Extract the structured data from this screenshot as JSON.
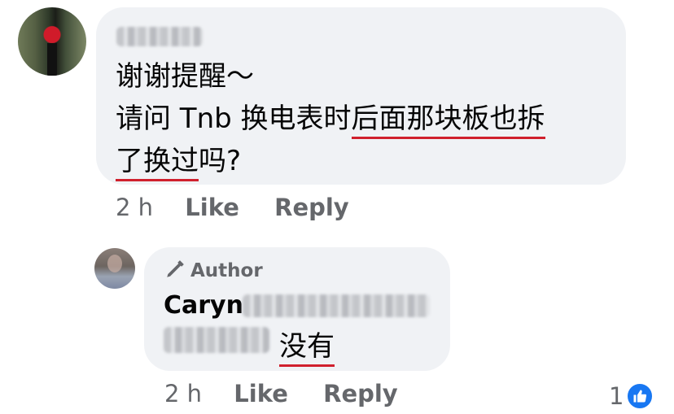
{
  "comment": {
    "lines": [
      "谢谢提醒～",
      "请问 Tnb 换电表时",
      "后面那块板也拆",
      "了换过",
      "吗?"
    ],
    "actions": {
      "time": "2 h",
      "like_label": "Like",
      "reply_label": "Reply"
    }
  },
  "reply": {
    "badge_label": "Author",
    "author_first_name": "Caryn",
    "text": "没有",
    "actions": {
      "time": "2 h",
      "like_label": "Like",
      "reply_label": "Reply"
    },
    "reaction_count": "1"
  },
  "colors": {
    "bubble": "#f0f2f5",
    "underline": "#d0202d",
    "meta_text": "#65676b",
    "like_blue": "#1877f2"
  },
  "icons": {
    "author_badge": "pencil-icon",
    "reaction": "thumbs-up-icon"
  }
}
